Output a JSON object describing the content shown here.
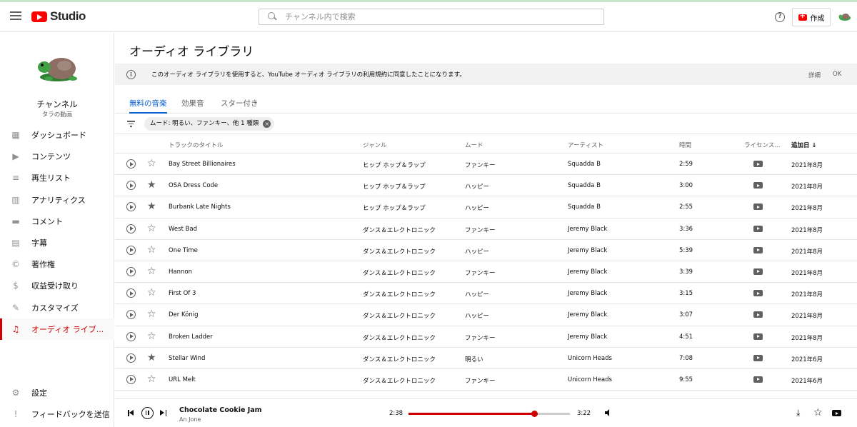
{
  "app": {
    "logo_text": "Studio"
  },
  "search": {
    "placeholder": "チャンネル内で検索"
  },
  "header": {
    "help_label": "?",
    "create_label": "作成"
  },
  "channel": {
    "name": "チャンネル",
    "subtitle": "タラの動画"
  },
  "sidebar": {
    "items": [
      {
        "label": "ダッシュボード",
        "icon": "dashboard-icon",
        "glyph": "▦"
      },
      {
        "label": "コンテンツ",
        "icon": "content-icon",
        "glyph": "▶"
      },
      {
        "label": "再生リスト",
        "icon": "playlist-icon",
        "glyph": "≡"
      },
      {
        "label": "アナリティクス",
        "icon": "analytics-icon",
        "glyph": "▥"
      },
      {
        "label": "コメント",
        "icon": "comment-icon",
        "glyph": "▬"
      },
      {
        "label": "字幕",
        "icon": "subtitles-icon",
        "glyph": "▤"
      },
      {
        "label": "著作権",
        "icon": "copyright-icon",
        "glyph": "©"
      },
      {
        "label": "収益受け取り",
        "icon": "dollar-icon",
        "glyph": "$"
      },
      {
        "label": "カスタマイズ",
        "icon": "magic-wand-icon",
        "glyph": "✎"
      },
      {
        "label": "オーディオ ライブ...",
        "icon": "audio-library-icon",
        "glyph": "♫",
        "active": true
      }
    ],
    "bottom": [
      {
        "label": "設定",
        "icon": "gear-icon",
        "glyph": "⚙"
      },
      {
        "label": "フィードバックを送信",
        "icon": "feedback-icon",
        "glyph": "!"
      }
    ]
  },
  "main": {
    "title": "オーディオ ライブラリ",
    "notice": {
      "text": "このオーディオ ライブラリを使用すると、YouTube オーディオ ライブラリの利用規約に同意したことになります。",
      "details_label": "詳細",
      "ok_label": "OK"
    },
    "tabs": [
      {
        "label": "無料の音楽",
        "active": true
      },
      {
        "label": "効果音"
      },
      {
        "label": "スター付き"
      }
    ],
    "filter_chip": "ムード: 明るい、ファンキー、他 1 種類"
  },
  "table": {
    "headers": {
      "title": "トラックのタイトル",
      "genre": "ジャンル",
      "mood": "ムード",
      "artist": "アーティスト",
      "duration": "時間",
      "license": "ライセンス...",
      "added": "追加日 ↓"
    },
    "rows": [
      {
        "title": "Bay Street Billionaires",
        "genre": "ヒップ ホップ＆ラップ",
        "mood": "ファンキー",
        "artist": "Squadda B",
        "duration": "2:59",
        "added": "2021年8月",
        "starred": false
      },
      {
        "title": "OSA Dress Code",
        "genre": "ヒップ ホップ＆ラップ",
        "mood": "ハッピー",
        "artist": "Squadda B",
        "duration": "3:00",
        "added": "2021年8月",
        "starred": true
      },
      {
        "title": "Burbank Late Nights",
        "genre": "ヒップ ホップ＆ラップ",
        "mood": "ハッピー",
        "artist": "Squadda B",
        "duration": "2:55",
        "added": "2021年8月",
        "starred": true
      },
      {
        "title": "West Bad",
        "genre": "ダンス＆エレクトロニック",
        "mood": "ファンキー",
        "artist": "Jeremy Black",
        "duration": "3:36",
        "added": "2021年8月",
        "starred": false
      },
      {
        "title": "One Time",
        "genre": "ダンス＆エレクトロニック",
        "mood": "ハッピー",
        "artist": "Jeremy Black",
        "duration": "5:39",
        "added": "2021年8月",
        "starred": false
      },
      {
        "title": "Hannon",
        "genre": "ダンス＆エレクトロニック",
        "mood": "ファンキー",
        "artist": "Jeremy Black",
        "duration": "3:39",
        "added": "2021年8月",
        "starred": false
      },
      {
        "title": "First Of 3",
        "genre": "ダンス＆エレクトロニック",
        "mood": "ハッピー",
        "artist": "Jeremy Black",
        "duration": "3:15",
        "added": "2021年8月",
        "starred": false
      },
      {
        "title": "Der König",
        "genre": "ダンス＆エレクトロニック",
        "mood": "ハッピー",
        "artist": "Jeremy Black",
        "duration": "3:07",
        "added": "2021年8月",
        "starred": false
      },
      {
        "title": "Broken Ladder",
        "genre": "ダンス＆エレクトロニック",
        "mood": "ファンキー",
        "artist": "Jeremy Black",
        "duration": "4:51",
        "added": "2021年8月",
        "starred": false
      },
      {
        "title": "Stellar Wind",
        "genre": "ダンス＆エレクトロニック",
        "mood": "明るい",
        "artist": "Unicorn Heads",
        "duration": "7:08",
        "added": "2021年6月",
        "starred": true
      },
      {
        "title": "URL Melt",
        "genre": "ダンス＆エレクトロニック",
        "mood": "ファンキー",
        "artist": "Unicorn Heads",
        "duration": "9:55",
        "added": "2021年6月",
        "starred": false
      }
    ]
  },
  "player": {
    "track_title": "Chocolate Cookie Jam",
    "track_artist": "An Jone",
    "current_time": "2:38",
    "total_time": "3:22",
    "progress": 0.78
  },
  "colors": {
    "accent": "#cc0000",
    "link": "#065fd4",
    "brand": "#ff0000"
  }
}
